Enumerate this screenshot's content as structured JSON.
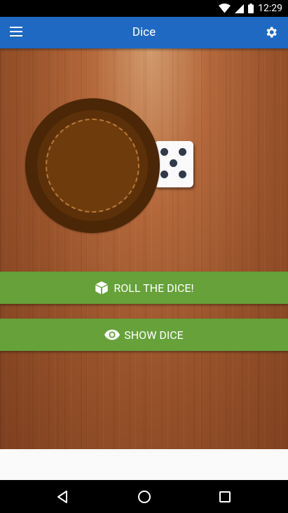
{
  "status_bar": {
    "time": "12:29",
    "icons": [
      "wifi-icon",
      "signal-icon",
      "battery-icon"
    ]
  },
  "app_bar": {
    "title": "Dice",
    "left_icon": "menu-icon",
    "right_icon": "settings-icon",
    "color": "#1f69c2"
  },
  "game": {
    "die_face": 5
  },
  "buttons": {
    "roll_label": "ROLL THE DICE!",
    "roll_icon": "cube-icon",
    "show_label": "SHOW DICE",
    "show_icon": "eye-icon",
    "color": "#66a13a"
  },
  "nav_bar": {
    "items": [
      "back-icon",
      "home-icon",
      "recents-icon"
    ]
  }
}
